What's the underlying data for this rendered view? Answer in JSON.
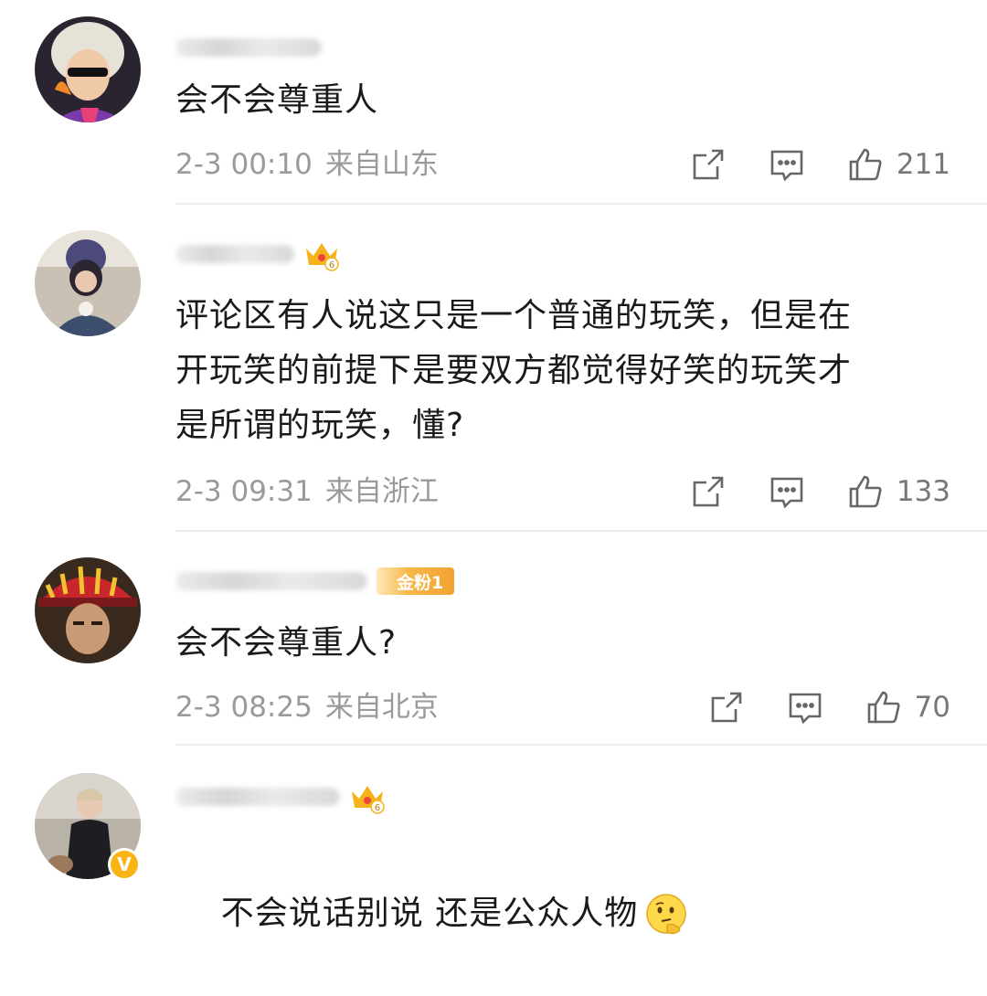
{
  "comments": [
    {
      "text": "会不会尊重人",
      "time": "2-3 00:10",
      "location": "来自山东",
      "likes": "211"
    },
    {
      "text": "评论区有人说这只是一个普通的玩笑，但是在\n开玩笑的前提下是要双方都觉得好笑的玩笑才\n是所谓的玩笑，懂?",
      "time": "2-3 09:31",
      "location": "来自浙江",
      "likes": "133",
      "badge_level": "6"
    },
    {
      "text": "会不会尊重人?",
      "time": "2-3 08:25",
      "location": "来自北京",
      "likes": "70",
      "fan_badge": "金粉1"
    },
    {
      "text": "不会说话别说 还是公众人物",
      "badge_level": "6",
      "verified_badge": "V"
    }
  ],
  "icons": {
    "share": "share-icon",
    "comment": "comment-icon",
    "like": "like-icon",
    "crown": "crown-badge-icon",
    "emoji": "thinking-emoji-icon"
  },
  "colors": {
    "meta_text": "#9a9a9a",
    "fan_badge": "#f2a230",
    "verified": "#f8b414"
  }
}
